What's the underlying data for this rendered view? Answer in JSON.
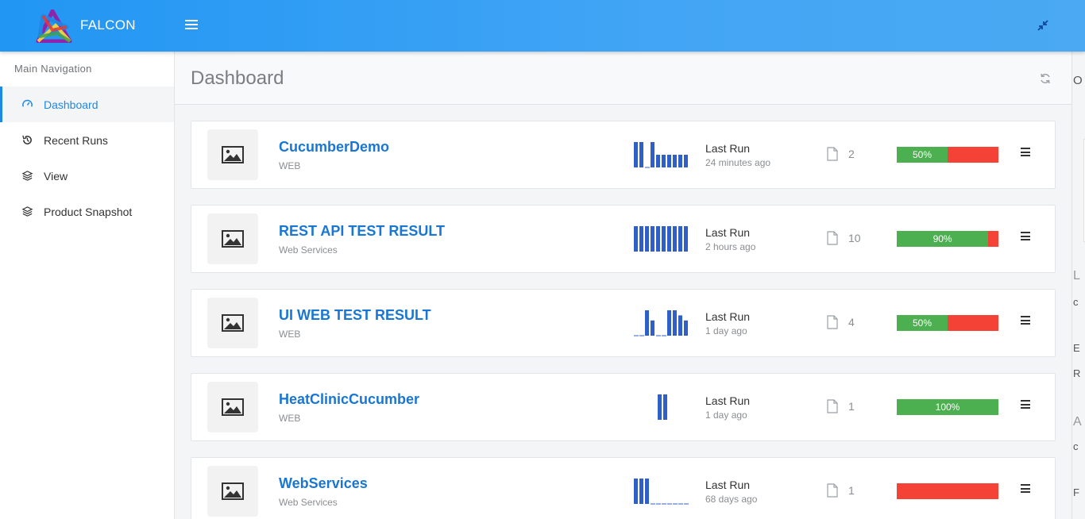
{
  "app": {
    "brand": "FALCON"
  },
  "sidebar": {
    "header": "Main Navigation",
    "items": [
      {
        "label": "Dashboard",
        "icon": "gauge-icon",
        "active": true
      },
      {
        "label": "Recent Runs",
        "icon": "history-icon",
        "active": false
      },
      {
        "label": "View",
        "icon": "layers-icon",
        "active": false
      },
      {
        "label": "Product Snapshot",
        "icon": "layers-icon",
        "active": false
      }
    ]
  },
  "page": {
    "title": "Dashboard"
  },
  "colors": {
    "accent": "#1e88e5",
    "pass": "#4caf50",
    "fail": "#f44336",
    "bars": "#2f5fc7"
  },
  "projects": [
    {
      "name": "CucumberDemo",
      "type": "WEB",
      "last_run_label": "Last Run",
      "last_run_time": "24 minutes ago",
      "file_count": "2",
      "pass_percent": 50,
      "pass_label": "50%",
      "runs": [
        1,
        1,
        0,
        1,
        0.5,
        0.5,
        0.5,
        0.5,
        0.5,
        0.5
      ]
    },
    {
      "name": "REST API TEST RESULT",
      "type": "Web Services",
      "last_run_label": "Last Run",
      "last_run_time": "2 hours ago",
      "file_count": "10",
      "pass_percent": 90,
      "pass_label": "90%",
      "runs": [
        1,
        1,
        1,
        1,
        1,
        1,
        1,
        1,
        1,
        1
      ]
    },
    {
      "name": "UI WEB TEST RESULT",
      "type": "WEB",
      "last_run_label": "Last Run",
      "last_run_time": "1 day ago",
      "file_count": "4",
      "pass_percent": 50,
      "pass_label": "50%",
      "runs": [
        0,
        0,
        1,
        0.6,
        0,
        0,
        1,
        1,
        0.8,
        0.6
      ]
    },
    {
      "name": "HeatClinicCucumber",
      "type": "WEB",
      "last_run_label": "Last Run",
      "last_run_time": "1 day ago",
      "file_count": "1",
      "pass_percent": 100,
      "pass_label": "100%",
      "runs": [
        1,
        1
      ]
    },
    {
      "name": "WebServices",
      "type": "Web Services",
      "last_run_label": "Last Run",
      "last_run_time": "68 days ago",
      "file_count": "1",
      "pass_percent": 0,
      "pass_label": "",
      "runs": [
        1,
        1,
        1,
        0,
        0,
        0,
        0,
        0,
        0,
        0
      ]
    }
  ],
  "right_panel": {
    "fragments": [
      "O",
      "L",
      "c",
      "E",
      "R",
      "A",
      "c",
      "F"
    ]
  }
}
